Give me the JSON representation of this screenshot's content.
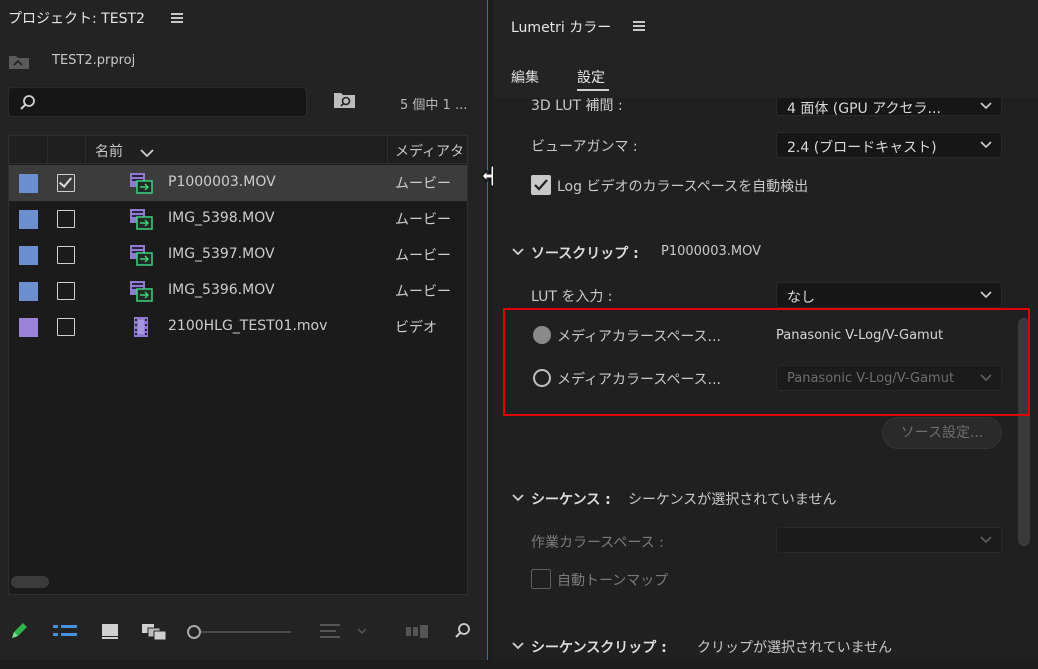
{
  "project_panel": {
    "title": "プロジェクト: TEST2",
    "project_file": "TEST2.prproj",
    "search": {
      "value": "",
      "placeholder": ""
    },
    "item_count": "5 個中 1 ...",
    "columns": {
      "name": "名前",
      "media_type": "メディアタ"
    },
    "items": [
      {
        "name": "P1000003.MOV",
        "type": "ムービー",
        "color": "#6b8fcf",
        "checked": true,
        "selected": true,
        "icon": "video-audio-clip-icon"
      },
      {
        "name": "IMG_5398.MOV",
        "type": "ムービー",
        "color": "#6b8fcf",
        "checked": false,
        "selected": false,
        "icon": "video-audio-clip-icon"
      },
      {
        "name": "IMG_5397.MOV",
        "type": "ムービー",
        "color": "#6b8fcf",
        "checked": false,
        "selected": false,
        "icon": "video-audio-clip-icon"
      },
      {
        "name": "IMG_5396.MOV",
        "type": "ムービー",
        "color": "#6b8fcf",
        "checked": false,
        "selected": false,
        "icon": "video-audio-clip-icon"
      },
      {
        "name": "2100HLG_TEST01.mov",
        "type": "ビデオ",
        "color": "#9b84d8",
        "checked": false,
        "selected": false,
        "icon": "video-clip-icon"
      }
    ],
    "toolbar_icons": [
      "pencil-icon",
      "list-view-icon",
      "icon-view-icon",
      "freeform-view-icon",
      "zoom-slider",
      "sort-icons-icon",
      "automate-to-sequence-icon",
      "find-icon"
    ]
  },
  "lumetri_panel": {
    "title": "Lumetri カラー",
    "tabs": {
      "edit": "編集",
      "settings": "設定"
    },
    "lut_range_label": "3D LUT 補間 :",
    "lut_range_value": "4 面体 (GPU アクセラ...",
    "viewer_gamma_label": "ビューアガンマ :",
    "viewer_gamma_value": "2.4 (ブロードキャスト)",
    "log_detect_label": "Log ビデオのカラースペースを自動検出",
    "log_detect_checked": true,
    "source_clip": {
      "title": "ソースクリップ :",
      "clip": "P1000003.MOV"
    },
    "input_lut_label": "LUT を入力 :",
    "input_lut_value": "なし",
    "media_cs_label_1": "メディアカラースペース...",
    "media_cs_value_1": "Panasonic V-Log/V-Gamut",
    "media_cs_label_2": "メディアカラースペース...",
    "media_cs_value_2": "Panasonic V-Log/V-Gamut",
    "source_settings_button": "ソース設定...",
    "sequence": {
      "title": "シーケンス :",
      "status": "シーケンスが選択されていません"
    },
    "working_cs_label": "作業カラースペース :",
    "auto_tonemap_label": "自動トーンマップ",
    "sequence_clip": {
      "title": "シーケンスクリップ :",
      "status": "クリップが選択されていません"
    },
    "colors": {
      "highlight": "#e00000",
      "panel_border": "#3a6db5"
    }
  }
}
